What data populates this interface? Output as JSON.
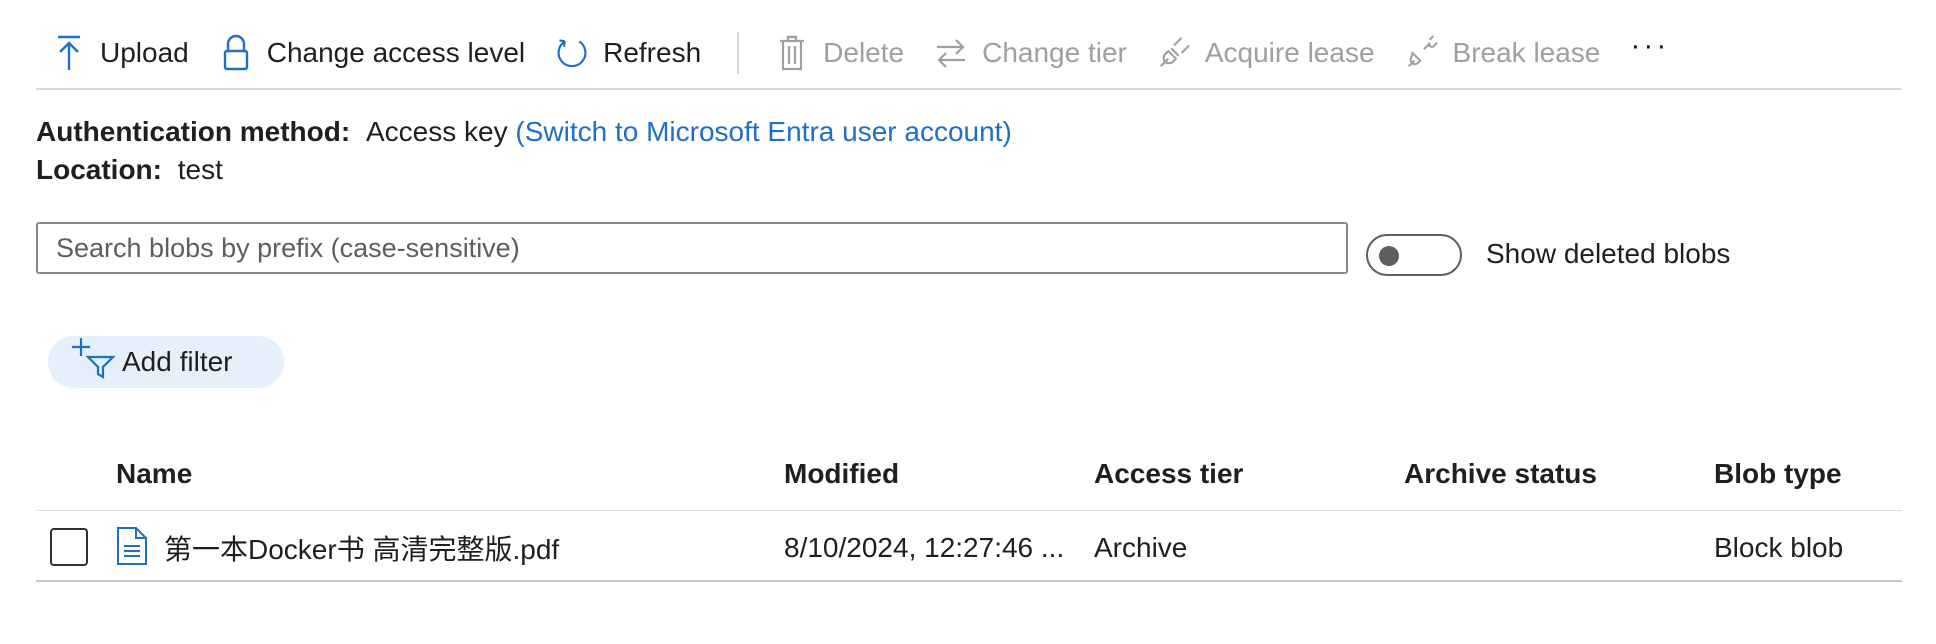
{
  "toolbar": {
    "upload": "Upload",
    "change_access": "Change access level",
    "refresh": "Refresh",
    "delete": "Delete",
    "change_tier": "Change tier",
    "acquire_lease": "Acquire lease",
    "break_lease": "Break lease",
    "more": "···"
  },
  "auth": {
    "label": "Authentication method:",
    "value": "Access key",
    "switch_link": "(Switch to Microsoft Entra user account)"
  },
  "location": {
    "label": "Location:",
    "value": "test"
  },
  "search": {
    "placeholder": "Search blobs by prefix (case-sensitive)"
  },
  "show_deleted": {
    "label": "Show deleted blobs",
    "on": false
  },
  "filter": {
    "label": "Add filter"
  },
  "table": {
    "columns": [
      "Name",
      "Modified",
      "Access tier",
      "Archive status",
      "Blob type"
    ],
    "rows": [
      {
        "name": "第一本Docker书 高清完整版.pdf",
        "modified": "8/10/2024, 12:27:46 ...",
        "access_tier": "Archive",
        "archive_status": "",
        "blob_type": "Block blob",
        "icon": "document-icon"
      }
    ]
  },
  "colors": {
    "accent": "#1f6fc5",
    "disabled": "#a19f9d",
    "filter_bg": "#e6f0fa"
  }
}
